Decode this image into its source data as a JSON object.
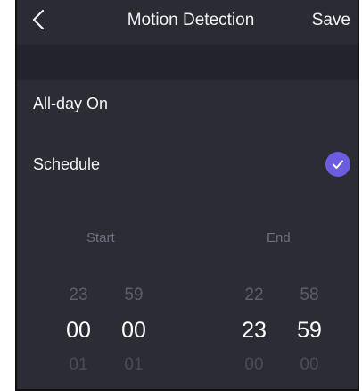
{
  "nav": {
    "title": "Motion Detection",
    "save_label": "Save",
    "back_icon": "chevron-left-icon"
  },
  "options": {
    "all_day_label": "All-day On",
    "schedule_label": "Schedule",
    "schedule_checked": true,
    "check_color": "#6b5ce0"
  },
  "time_picker": {
    "start_label": "Start",
    "end_label": "End",
    "start": {
      "hours": [
        "23",
        "00",
        "01"
      ],
      "minutes": [
        "59",
        "00",
        "01"
      ]
    },
    "end": {
      "hours": [
        "22",
        "23",
        "00"
      ],
      "minutes": [
        "58",
        "59",
        "00"
      ]
    }
  },
  "colors": {
    "background": "#2b2c34",
    "section_gap": "#23242b",
    "text": "#f4f4f6",
    "muted": "#6f7080"
  }
}
